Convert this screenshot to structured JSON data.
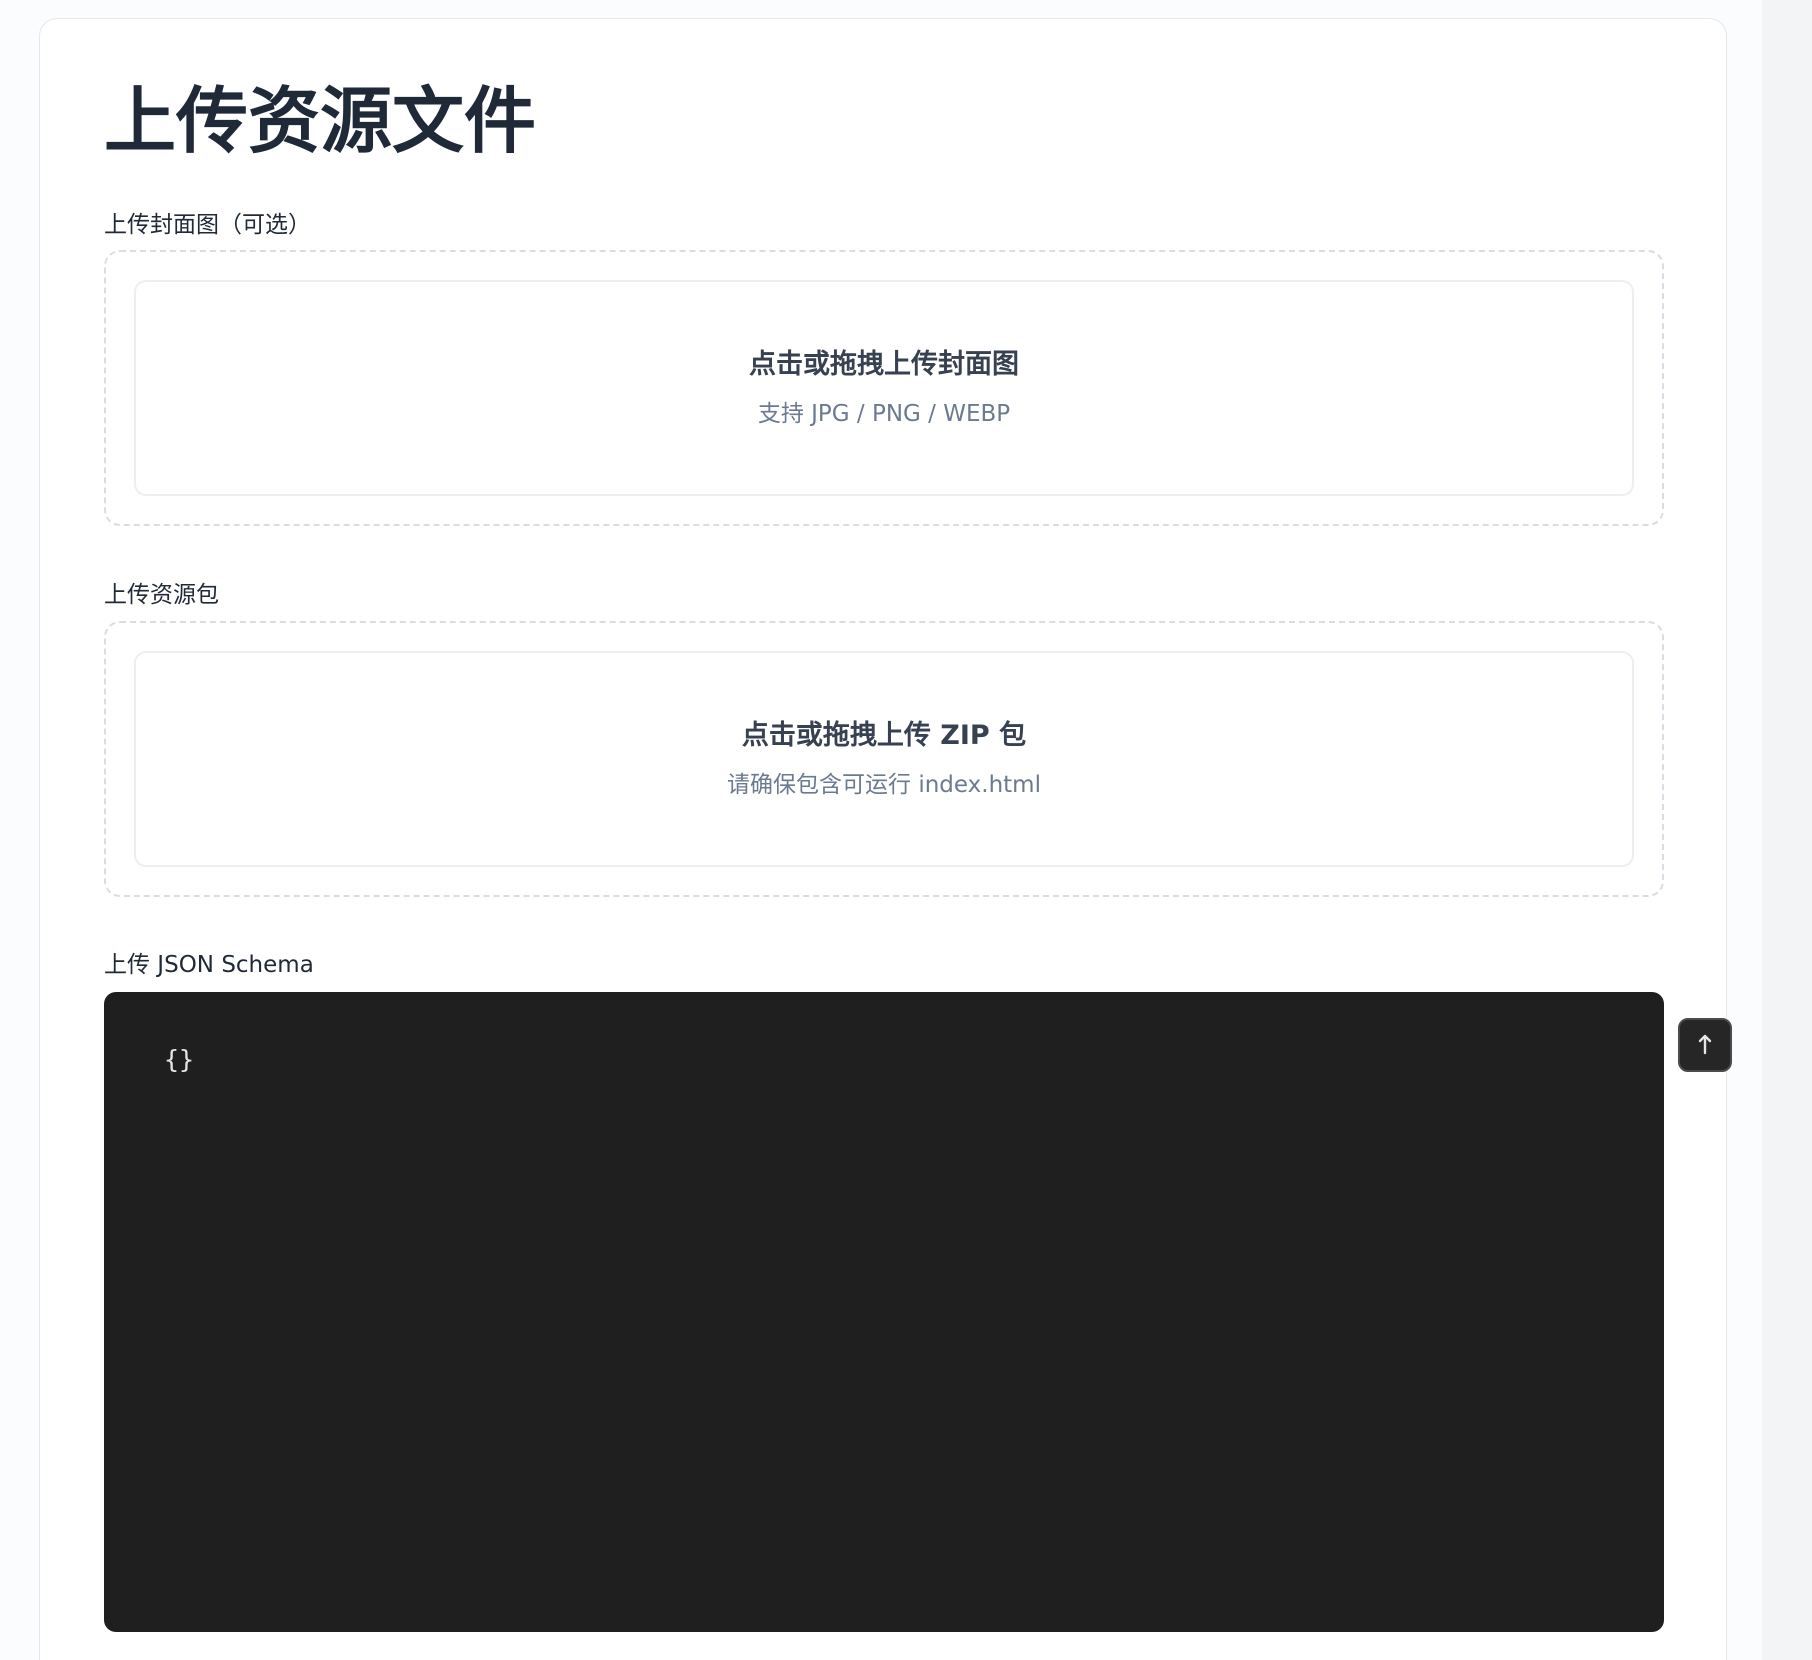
{
  "page": {
    "title": "上传资源文件"
  },
  "sections": {
    "cover": {
      "label": "上传封面图（可选）",
      "drop_title": "点击或拖拽上传封面图",
      "drop_hint": "支持 JPG / PNG / WEBP"
    },
    "package": {
      "label": "上传资源包",
      "drop_title": "点击或拖拽上传 ZIP 包",
      "drop_hint": "请确保包含可运行 index.html"
    },
    "schema": {
      "label": "上传 JSON Schema",
      "code_value": "{}",
      "upload_icon": "upload-icon"
    }
  },
  "colors": {
    "editor_background": "#1f1f1f",
    "hint_text": "#6b7a90",
    "title_text": "#1f2937"
  }
}
